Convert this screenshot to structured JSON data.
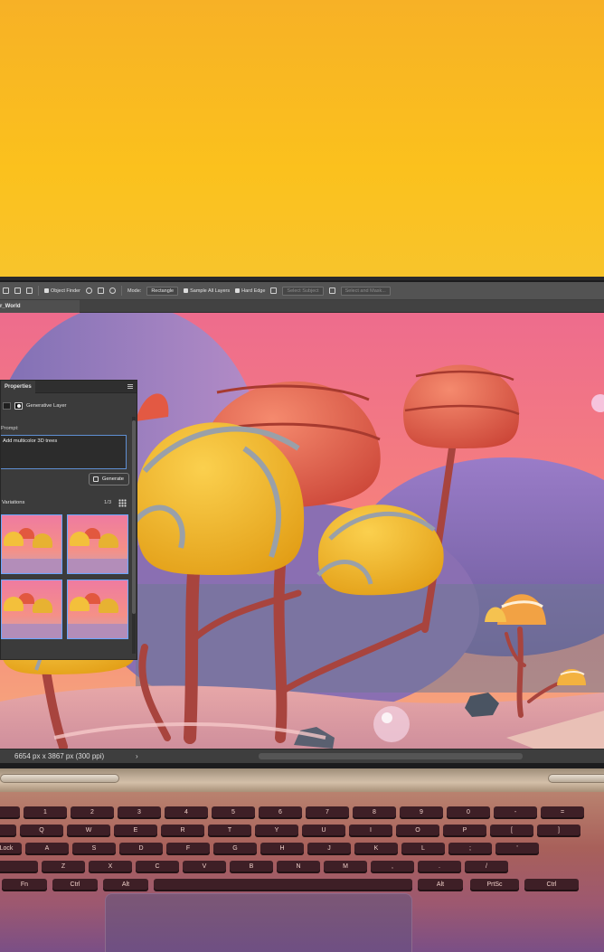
{
  "toolbar": {
    "object_finder": "Object Finder",
    "mode_label": "Mode:",
    "mode_value": "Rectangle",
    "sample_all_layers": "Sample All Layers",
    "hard_edge": "Hard Edge",
    "select_subject": "Select Subject",
    "select_mask": "Select and Mask..."
  },
  "document": {
    "tab_title": "r_World"
  },
  "properties": {
    "tab": "Properties",
    "layer_type": "Generative Layer",
    "prompt_label": "Prompt:",
    "prompt_value": "Add multicolor 3D trees",
    "generate_label": "Generate",
    "variations_label": "Variations",
    "variations_count": "1/3"
  },
  "status": {
    "dimensions": "6654 px x 3867 px (300 ppi)",
    "arrow": "›"
  },
  "keyboard": {
    "row1": [
      "1",
      "2",
      "3",
      "4",
      "5",
      "6",
      "7",
      "8",
      "9",
      "0",
      "-",
      "="
    ],
    "row2": [
      "Q",
      "W",
      "E",
      "R",
      "T",
      "Y",
      "U",
      "I",
      "O",
      "P",
      "[",
      "]"
    ],
    "row3_lead": "Lock",
    "row3": [
      "A",
      "S",
      "D",
      "F",
      "G",
      "H",
      "J",
      "K",
      "L",
      ";",
      "'"
    ],
    "row4": [
      "Z",
      "X",
      "C",
      "V",
      "B",
      "N",
      "M",
      ",",
      ".",
      "/"
    ],
    "row5": [
      "Fn",
      "Ctrl",
      "Alt",
      "Alt",
      "PrtSc",
      "Ctrl"
    ]
  },
  "colors": {
    "panel_accent": "#69a6ff",
    "backdrop": "#fbc11d"
  }
}
